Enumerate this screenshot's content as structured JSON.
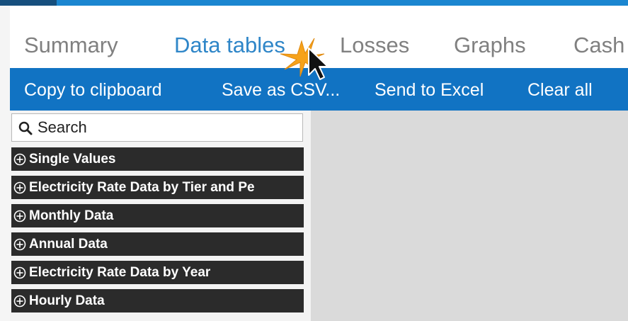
{
  "tabs": [
    {
      "label": "Summary"
    },
    {
      "label": "Data tables"
    },
    {
      "label": "Losses"
    },
    {
      "label": "Graphs"
    },
    {
      "label": "Cash"
    }
  ],
  "active_tab": "Data tables",
  "toolbar": {
    "copy_label": "Copy to clipboard",
    "csv_label": "Save as CSV...",
    "excel_label": "Send to Excel",
    "clear_label": "Clear all"
  },
  "search": {
    "placeholder": "Search",
    "value": ""
  },
  "groups": [
    {
      "label": "Single Values"
    },
    {
      "label": "Electricity Rate Data by Tier and Pe"
    },
    {
      "label": "Monthly Data"
    },
    {
      "label": "Annual Data"
    },
    {
      "label": "Electricity Rate Data by Year"
    },
    {
      "label": "Hourly Data"
    }
  ],
  "icons": {
    "search": "magnifier-icon",
    "expand": "circled-plus-icon",
    "cursor": "mouse-pointer-icon"
  },
  "colors": {
    "accent_blue": "#2f86c8",
    "toolbar_blue": "#1173c3",
    "group_bg": "#2b2b2b",
    "tab_inactive": "#808080",
    "content_bg": "#dadada"
  }
}
